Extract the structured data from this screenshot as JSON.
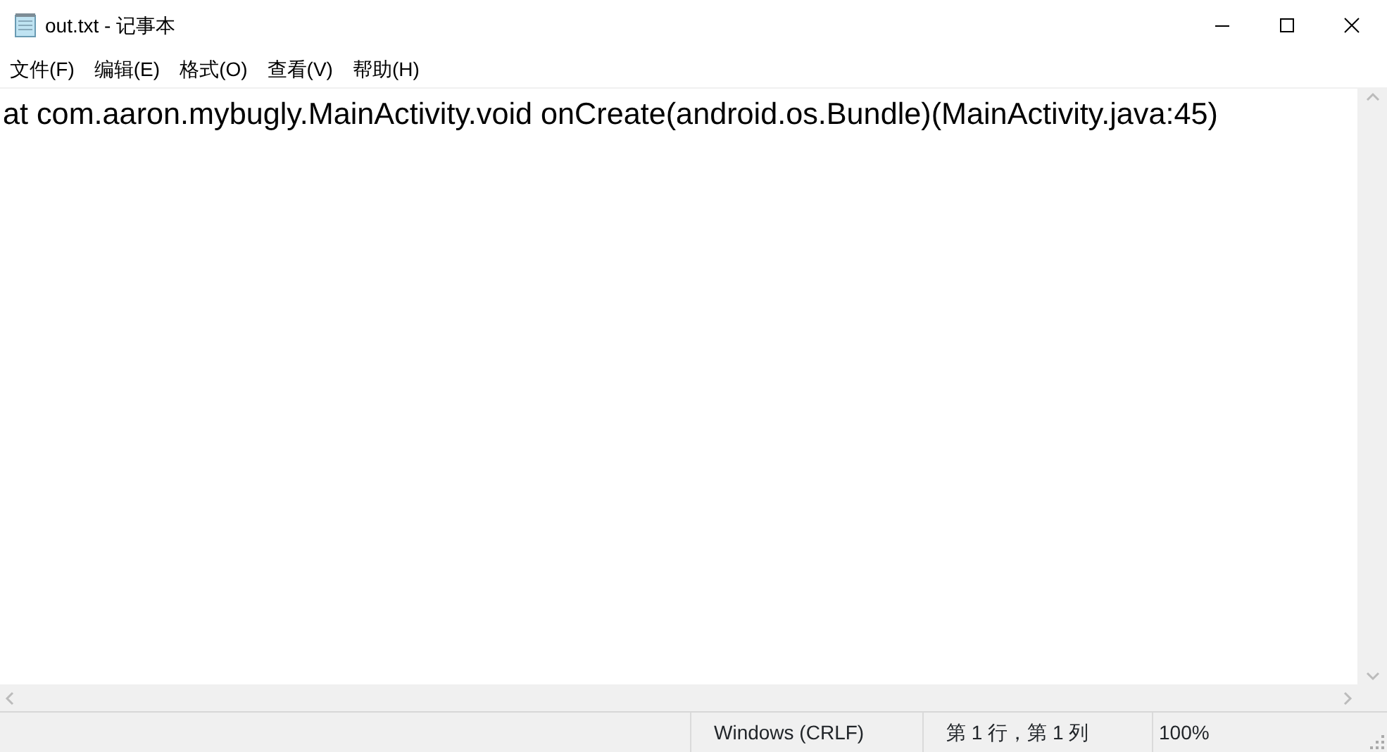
{
  "window": {
    "title": "out.txt - 记事本"
  },
  "menu": [
    "文件(F)",
    "编辑(E)",
    "格式(O)",
    "查看(V)",
    "帮助(H)"
  ],
  "editor": {
    "lines": [
      "at com.aaron.mybugly.MainActivity.void onCreate(android.os.Bundle)(MainActivity.java:45)"
    ]
  },
  "status_bar": [
    "Windows (CRLF)",
    "第 1 行，第 1 列",
    "100%"
  ]
}
